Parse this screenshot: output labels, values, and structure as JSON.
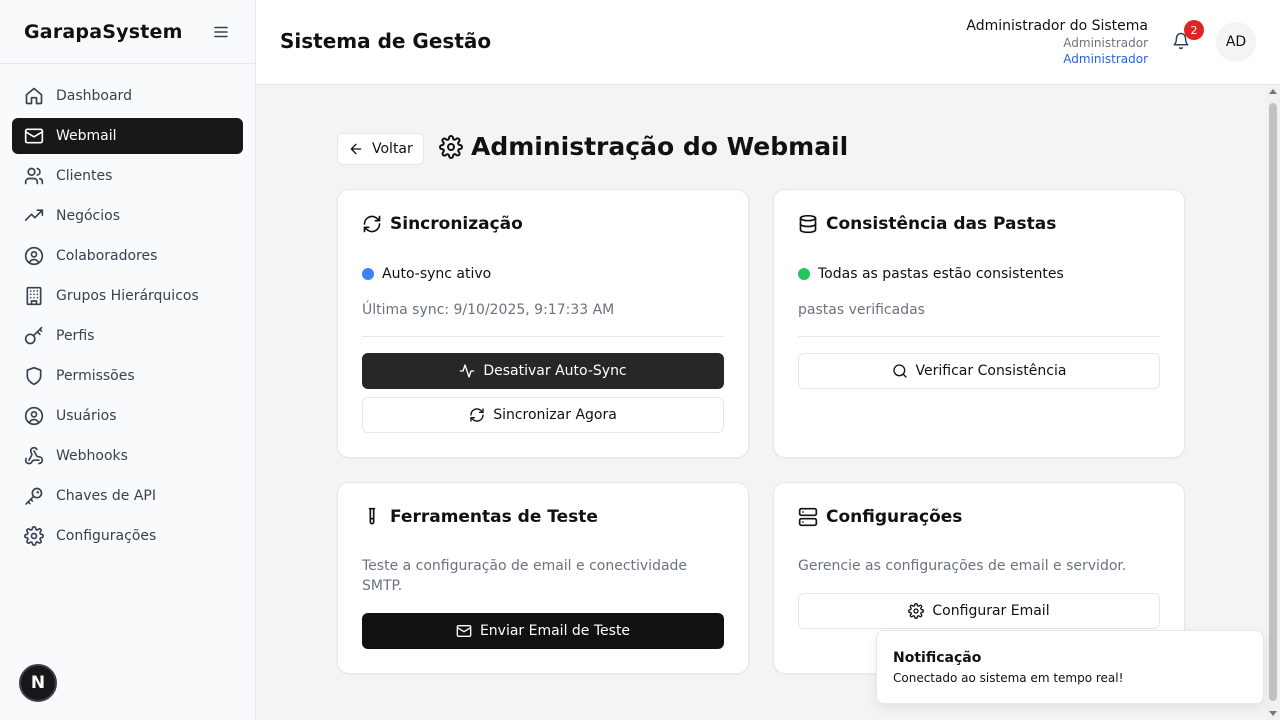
{
  "sidebar": {
    "brand": "GarapaSystem",
    "items": [
      {
        "label": "Dashboard",
        "icon": "home-icon"
      },
      {
        "label": "Webmail",
        "icon": "mail-icon",
        "active": true
      },
      {
        "label": "Clientes",
        "icon": "users-icon"
      },
      {
        "label": "Negócios",
        "icon": "trending-up-icon"
      },
      {
        "label": "Colaboradores",
        "icon": "user-circle-icon"
      },
      {
        "label": "Grupos Hierárquicos",
        "icon": "building-icon"
      },
      {
        "label": "Perfis",
        "icon": "key-icon"
      },
      {
        "label": "Permissões",
        "icon": "shield-icon"
      },
      {
        "label": "Usuários",
        "icon": "user-circle-icon"
      },
      {
        "label": "Webhooks",
        "icon": "webhook-icon"
      },
      {
        "label": "Chaves de API",
        "icon": "key-round-icon"
      },
      {
        "label": "Configurações",
        "icon": "gear-icon"
      }
    ],
    "next_badge": "N"
  },
  "header": {
    "title": "Sistema de Gestão",
    "user_name": "Administrador do Sistema",
    "user_role": "Administrador",
    "user_role_link": "Administrador",
    "notification_count": "2",
    "avatar_initials": "AD"
  },
  "page": {
    "back_label": "Voltar",
    "title": "Administração do Webmail"
  },
  "sync_card": {
    "title": "Sincronização",
    "status": "Auto-sync ativo",
    "status_color": "#3b82f6",
    "last_sync": "Última sync: 9/10/2025, 9:17:33 AM",
    "toggle_label": "Desativar Auto-Sync",
    "sync_now_label": "Sincronizar Agora"
  },
  "consistency_card": {
    "title": "Consistência das Pastas",
    "status": "Todas as pastas estão consistentes",
    "status_color": "#22c55e",
    "checked": "pastas verificadas",
    "verify_label": "Verificar Consistência"
  },
  "test_card": {
    "title": "Ferramentas de Teste",
    "description": "Teste a configuração de email e conectividade SMTP.",
    "send_label": "Enviar Email de Teste"
  },
  "config_card": {
    "title": "Configurações",
    "description": "Gerencie as configurações de email e servidor.",
    "configure_label": "Configurar Email"
  },
  "toast": {
    "title": "Notificação",
    "message": "Conectado ao sistema em tempo real!"
  }
}
